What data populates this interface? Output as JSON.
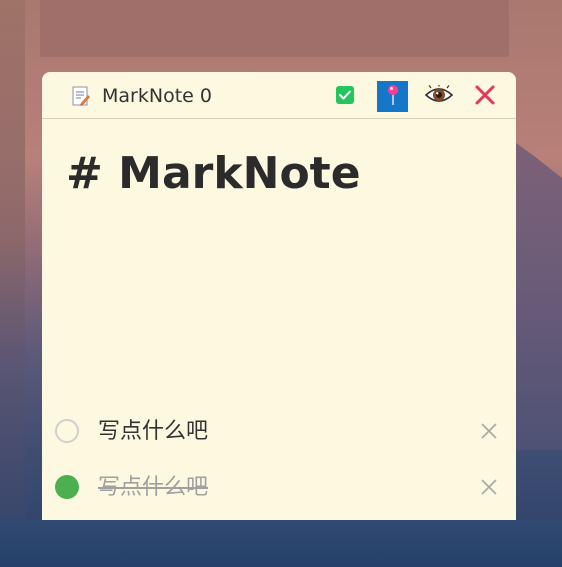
{
  "window": {
    "title": "MarkNote 0"
  },
  "toolbar": {
    "icons": [
      "checkbox-icon",
      "pin-icon",
      "eye-icon",
      "close-icon"
    ],
    "colors": {
      "check": "#22c55e",
      "pin_bg": "#1577c9",
      "close": "#e8345a"
    }
  },
  "content": {
    "heading": "# MarkNote"
  },
  "todos": [
    {
      "text": "写点什么吧",
      "done": false
    },
    {
      "text": "写点什么吧",
      "done": true
    }
  ],
  "colors": {
    "note_bg": "#fdf8e0",
    "done_green": "#4caf50"
  }
}
